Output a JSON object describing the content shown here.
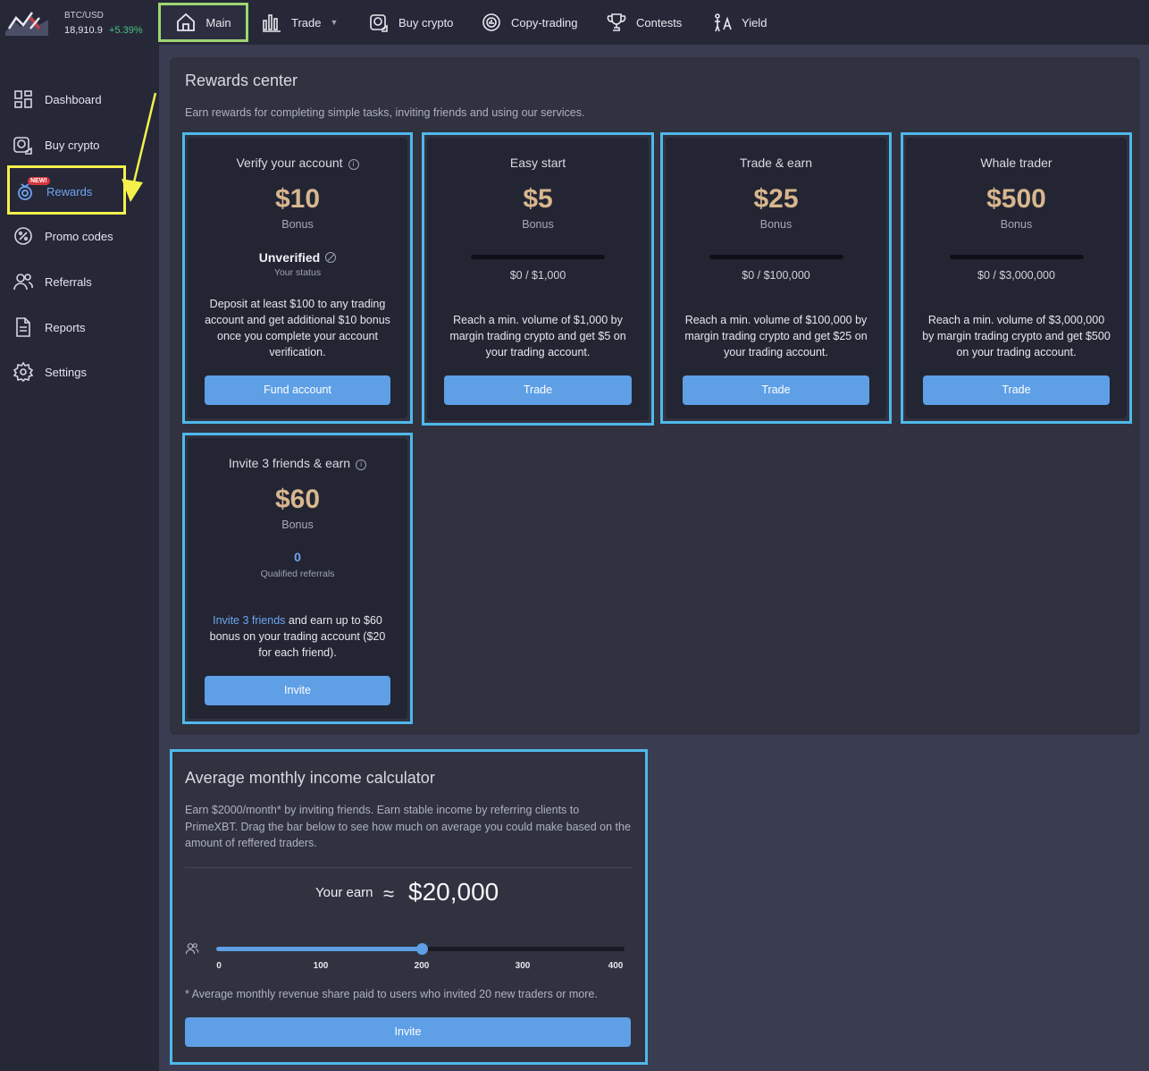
{
  "ticker": {
    "pair": "BTC/USD",
    "price": "18,910.9",
    "change": "+5.39%"
  },
  "topnav": {
    "main": "Main",
    "trade": "Trade",
    "buy_crypto": "Buy crypto",
    "copy_trading": "Copy-trading",
    "contests": "Contests",
    "yield": "Yield"
  },
  "sidebar": {
    "items": [
      {
        "label": "Dashboard",
        "icon": "dashboard-icon"
      },
      {
        "label": "Buy crypto",
        "icon": "buy-crypto-icon"
      },
      {
        "label": "Rewards",
        "icon": "rewards-icon",
        "badge": "NEW!"
      },
      {
        "label": "Promo codes",
        "icon": "promo-icon"
      },
      {
        "label": "Referrals",
        "icon": "referrals-icon"
      },
      {
        "label": "Reports",
        "icon": "reports-icon"
      },
      {
        "label": "Settings",
        "icon": "gear-icon"
      }
    ]
  },
  "rewards": {
    "title": "Rewards center",
    "subtitle": "Earn rewards for completing simple tasks, inviting friends and using our services.",
    "cards": [
      {
        "title": "Verify your account",
        "amount": "$10",
        "bonus_label": "Bonus",
        "status": "Unverified",
        "status_sub": "Your status",
        "description": "Deposit at least $100 to any trading account and get additional $10 bonus once you complete your account verification.",
        "button": "Fund account"
      },
      {
        "title": "Easy start",
        "amount": "$5",
        "bonus_label": "Bonus",
        "progress_text": "$0 / $1,000",
        "progress": 0,
        "description": "Reach a min. volume of $1,000 by margin trading crypto and get $5 on your trading account.",
        "button": "Trade"
      },
      {
        "title": "Trade & earn",
        "amount": "$25",
        "bonus_label": "Bonus",
        "progress_text": "$0 / $100,000",
        "progress": 0,
        "description": "Reach a min. volume of $100,000 by margin trading crypto and get $25 on your trading account.",
        "button": "Trade"
      },
      {
        "title": "Whale trader",
        "amount": "$500",
        "bonus_label": "Bonus",
        "progress_text": "$0 / $3,000,000",
        "progress": 0,
        "description": "Reach a min. volume of $3,000,000 by margin trading crypto and get $500 on your trading account.",
        "button": "Trade"
      },
      {
        "title": "Invite 3 friends & earn",
        "amount": "$60",
        "bonus_label": "Bonus",
        "referrals": "0",
        "referrals_label": "Qualified referrals",
        "description_link": "Invite 3 friends",
        "description": " and earn up to $60 bonus on your trading account ($20 for each friend).",
        "button": "Invite"
      }
    ]
  },
  "calculator": {
    "title": "Average monthly income calculator",
    "description": "Earn $2000/month* by inviting friends. Earn stable income by referring clients to PrimeXBT. Drag the bar below to see how much on average you could make based on the amount of reffered traders.",
    "earn_label": "Your earn",
    "approx": "≈",
    "earn_value": "$20,000",
    "slider": {
      "min": 0,
      "max": 400,
      "value": 200,
      "ticks": [
        "0",
        "100",
        "200",
        "300",
        "400"
      ]
    },
    "footnote": "* Average monthly revenue share paid to users who invited 20 new traders or more.",
    "button": "Invite"
  },
  "colors": {
    "accent": "#5e9fe6",
    "highlight_blue": "#4fb8ea",
    "highlight_yellow": "#f4f14c",
    "highlight_green": "#9dd672",
    "gold": "#d8b78e"
  }
}
